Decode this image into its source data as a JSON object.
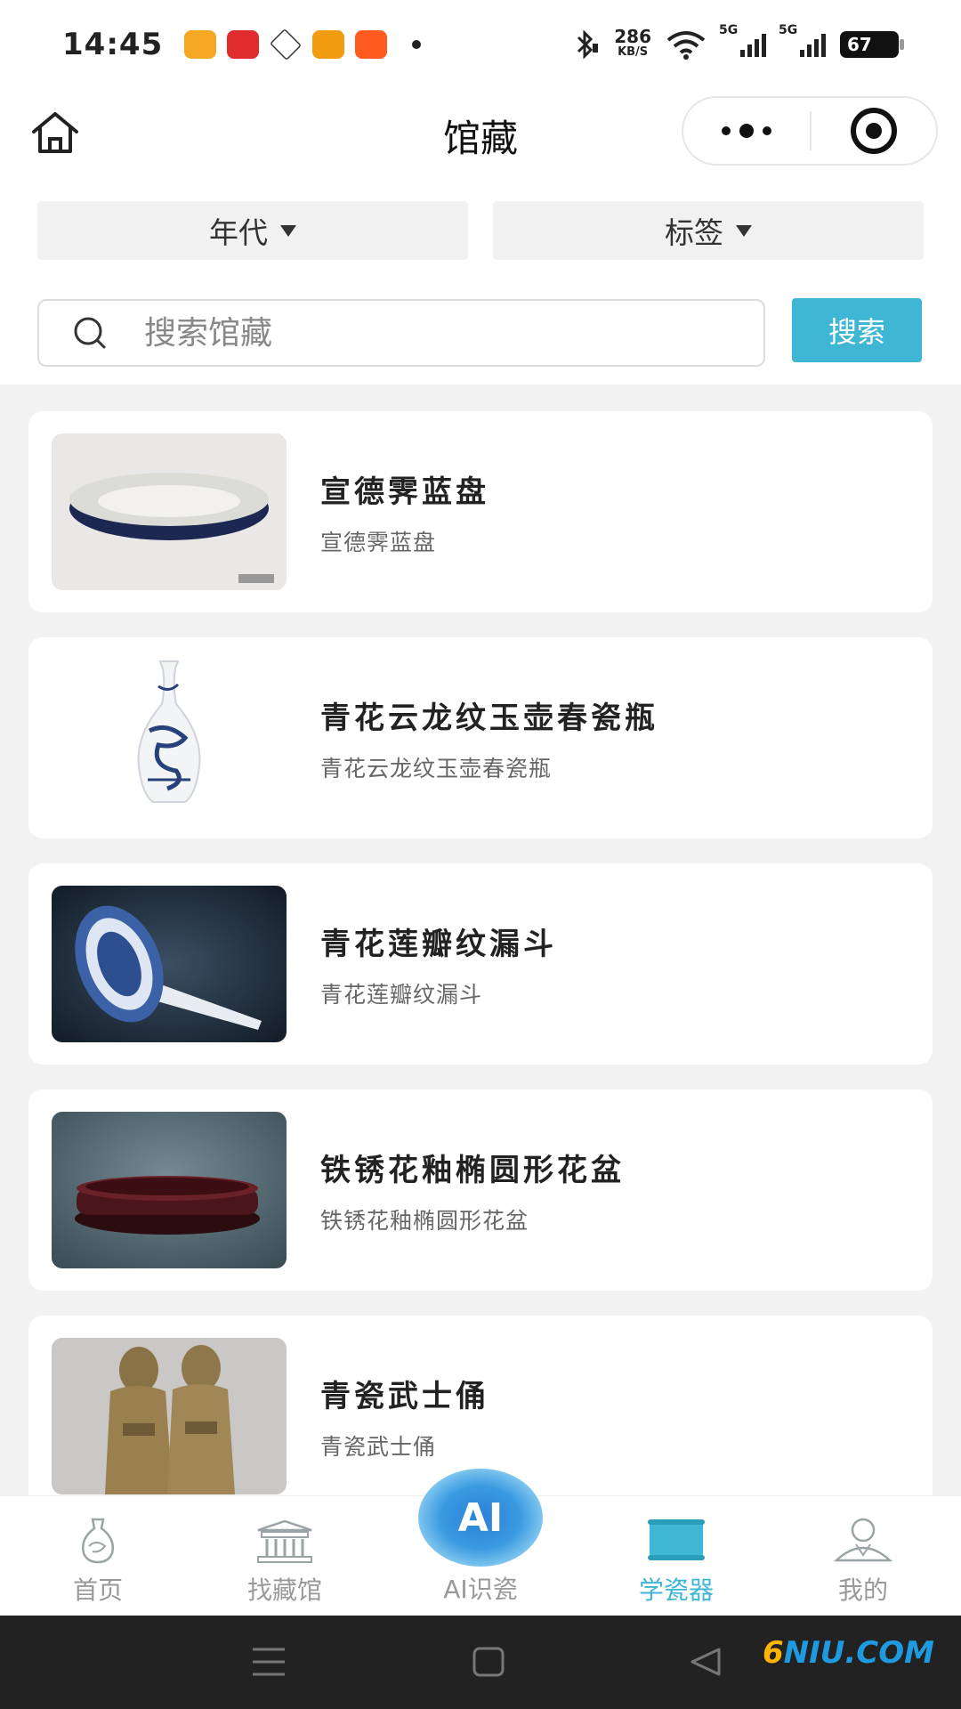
{
  "status_bar": {
    "time": "14:45",
    "net_speed_value": "286",
    "net_speed_unit": "KB/S",
    "signal_1": "5G",
    "signal_2": "5G",
    "battery": "67"
  },
  "header": {
    "title": "馆藏"
  },
  "filters": {
    "era_label": "年代",
    "tag_label": "标签"
  },
  "search": {
    "placeholder": "搜索馆藏",
    "button_label": "搜索"
  },
  "items": [
    {
      "title": "宣德霁蓝盘",
      "subtitle": "宣德霁蓝盘",
      "image": "plate-icon"
    },
    {
      "title": "青花云龙纹玉壶春瓷瓶",
      "subtitle": "青花云龙纹玉壶春瓷瓶",
      "image": "vase-icon"
    },
    {
      "title": "青花莲瓣纹漏斗",
      "subtitle": "青花莲瓣纹漏斗",
      "image": "funnel-icon"
    },
    {
      "title": "铁锈花釉椭圆形花盆",
      "subtitle": "铁锈花釉椭圆形花盆",
      "image": "flowerpot-icon"
    },
    {
      "title": "青瓷武士俑",
      "subtitle": "青瓷武士俑",
      "image": "warrior-figure-icon"
    }
  ],
  "tabbar": {
    "home": "首页",
    "find_museum": "找藏馆",
    "ai_badge": "AI",
    "ai_label": "AI识瓷",
    "learn": "学瓷器",
    "mine": "我的"
  },
  "watermark": {
    "prefix": "6",
    "text": "NIU.COM"
  },
  "colors": {
    "accent": "#3fb6d4",
    "inactive": "#999999"
  }
}
